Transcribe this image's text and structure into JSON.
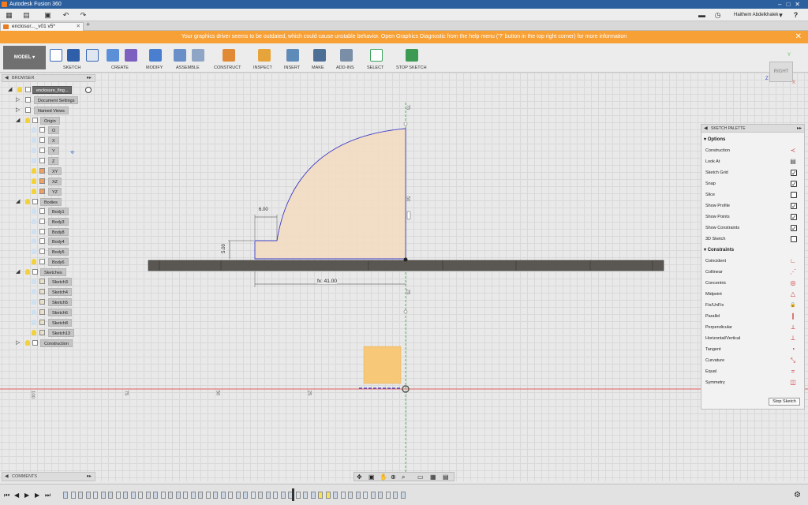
{
  "app": {
    "title": "Autodesk Fusion 360",
    "user": "Haithem Abdelkhalek"
  },
  "document_tab": {
    "label": "enclosur..._v01 v5*"
  },
  "warning": {
    "text": "Your graphics driver seems to be outdated, which could cause unstable behavior. Open Graphics Diagnostic from the help menu ('?' button in the top right corner) for more information"
  },
  "toolbar": {
    "mode": "MODEL",
    "groups": [
      "SKETCH",
      "CREATE",
      "MODIFY",
      "ASSEMBLE",
      "CONSTRUCT",
      "INSPECT",
      "INSERT",
      "MAKE",
      "ADD-INS",
      "SELECT",
      "STOP SKETCH"
    ]
  },
  "browser": {
    "title": "BROWSER",
    "root": "enclosure_fing...",
    "doc_settings": "Document Settings",
    "named_views": "Named Views",
    "origin": "Origin",
    "origin_items": [
      "O",
      "X",
      "Y",
      "Z",
      "XY",
      "XZ",
      "YZ"
    ],
    "bodies": "Bodies",
    "body_items": [
      "Body1",
      "Body3",
      "Body8",
      "Body4",
      "Body5",
      "Body6"
    ],
    "sketches": "Sketches",
    "sketch_items": [
      "Sketch3",
      "Sketch4",
      "Sketch5",
      "Sketch6",
      "Sketch8",
      "Sketch13"
    ],
    "construction": "Construction"
  },
  "comments": {
    "label": "COMMENTS"
  },
  "viewcube": {
    "face": "RIGHT",
    "axes": [
      "Y",
      "Z",
      "X"
    ]
  },
  "palette": {
    "title": "SKETCH PALETTE",
    "options_title": "Options",
    "options": [
      {
        "label": "Construction",
        "icon": "construction-icon"
      },
      {
        "label": "Look At",
        "icon": "look-at-icon"
      },
      {
        "label": "Sketch Grid",
        "icon": "checkbox"
      },
      {
        "label": "Snap",
        "icon": "checkbox"
      },
      {
        "label": "Slice",
        "icon": "checkbox"
      },
      {
        "label": "Show Profile",
        "icon": "checkbox"
      },
      {
        "label": "Show Points",
        "icon": "checkbox"
      },
      {
        "label": "Show Constraints",
        "icon": "checkbox"
      },
      {
        "label": "3D Sketch",
        "icon": "checkbox"
      }
    ],
    "option_checked": [
      false,
      false,
      true,
      true,
      false,
      true,
      true,
      true,
      false
    ],
    "constraints_title": "Constraints",
    "constraints": [
      {
        "label": "Coincident",
        "glyph": "∟"
      },
      {
        "label": "Collinear",
        "glyph": "⋰"
      },
      {
        "label": "Concentric",
        "glyph": "◎"
      },
      {
        "label": "Midpoint",
        "glyph": "△"
      },
      {
        "label": "Fix/UnFix",
        "glyph": "🔒"
      },
      {
        "label": "Parallel",
        "glyph": "∥"
      },
      {
        "label": "Perpendicular",
        "glyph": "⟂"
      },
      {
        "label": "Horizontal/Vertical",
        "glyph": "⊥"
      },
      {
        "label": "Tangent",
        "glyph": "◔"
      },
      {
        "label": "Curvature",
        "glyph": "⤡"
      },
      {
        "label": "Equal",
        "glyph": "="
      },
      {
        "label": "Symmetry",
        "glyph": "◫"
      }
    ],
    "stop_button": "Stop Sketch"
  },
  "sketch": {
    "dim_width": "fx: 41.00",
    "dim_step_w": "6.00",
    "dim_step_h": "5.00",
    "vertical_ruler": [
      "75",
      "50",
      "25"
    ],
    "horizontal_ruler": [
      "100",
      "75",
      "50",
      "25"
    ]
  },
  "colors": {
    "accent": "#f7a036",
    "profile_fill": "#f3dcc0",
    "sketch_line": "#3d3dc8",
    "axis_red": "#e06060",
    "axis_green": "#4cbf4c"
  }
}
